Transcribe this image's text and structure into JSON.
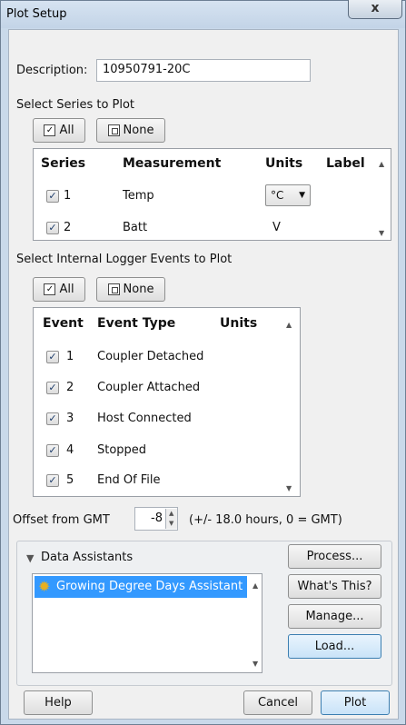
{
  "window": {
    "title": "Plot Setup",
    "close_glyph": "x"
  },
  "description": {
    "label": "Description:",
    "value": "10950791-20C"
  },
  "series_section": {
    "title": "Select Series to Plot",
    "all_label": "All",
    "none_label": "None",
    "headers": {
      "series": "Series",
      "measurement": "Measurement",
      "units": "Units",
      "label": "Label"
    },
    "rows": [
      {
        "checked": true,
        "num": "1",
        "measurement": "Temp",
        "units": "°C",
        "units_is_combo": true
      },
      {
        "checked": true,
        "num": "2",
        "measurement": "Batt",
        "units": "V",
        "units_is_combo": false
      }
    ]
  },
  "events_section": {
    "title": "Select Internal Logger Events to Plot",
    "all_label": "All",
    "none_label": "None",
    "headers": {
      "event": "Event",
      "event_type": "Event Type",
      "units": "Units"
    },
    "rows": [
      {
        "checked": true,
        "num": "1",
        "type": "Coupler Detached"
      },
      {
        "checked": true,
        "num": "2",
        "type": "Coupler Attached"
      },
      {
        "checked": true,
        "num": "3",
        "type": "Host Connected"
      },
      {
        "checked": true,
        "num": "4",
        "type": "Stopped"
      },
      {
        "checked": true,
        "num": "5",
        "type": "End Of File"
      }
    ]
  },
  "offset": {
    "label": "Offset from GMT",
    "value": "-8",
    "hint": "(+/- 18.0 hours, 0 = GMT)"
  },
  "assistants": {
    "title": "Data Assistants",
    "items": [
      {
        "label": "Growing Degree Days Assistant",
        "selected": true
      }
    ],
    "buttons": {
      "process": "Process...",
      "whats_this": "What's This?",
      "manage": "Manage...",
      "load": "Load..."
    }
  },
  "footer": {
    "help": "Help",
    "cancel": "Cancel",
    "plot": "Plot"
  },
  "icons": {
    "checkmark": "✓",
    "expand": "▼",
    "up": "▲",
    "down": "▼",
    "sun": "✹"
  },
  "colors": {
    "selection": "#3399ff",
    "sun": "#e8b020"
  }
}
